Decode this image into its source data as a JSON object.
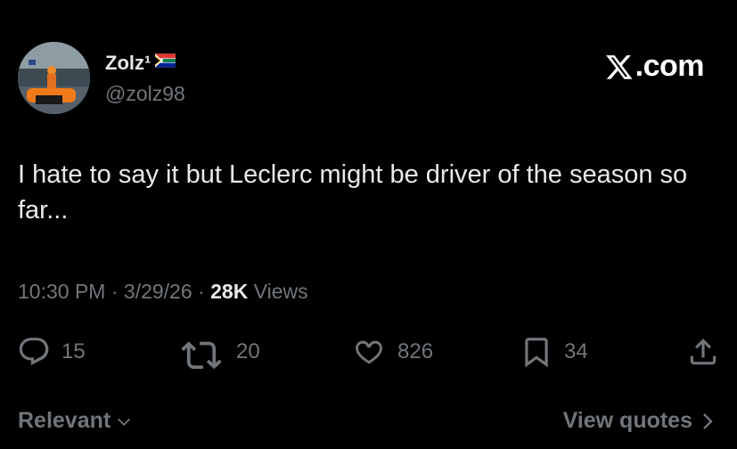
{
  "author": {
    "name": "Zolz¹",
    "handle": "@zolz98",
    "flag_icon": "south-africa-flag-icon"
  },
  "brand": {
    "label": ".com",
    "icon": "x-logo-icon"
  },
  "tweet": {
    "text": "I hate to say it but Leclerc might be driver of the season so far..."
  },
  "meta": {
    "time": "10:30 PM",
    "sep1": " · ",
    "date": "3/29/26",
    "sep2": " · ",
    "views_count": "28K",
    "views_label": " Views"
  },
  "actions": {
    "replies": "15",
    "reposts": "20",
    "likes": "826",
    "bookmarks": "34"
  },
  "footer": {
    "sort_label": "Relevant",
    "quotes_label": "View quotes"
  },
  "colors": {
    "background": "#000000",
    "primary_text": "#e7e9ea",
    "secondary_text": "#71767b"
  }
}
